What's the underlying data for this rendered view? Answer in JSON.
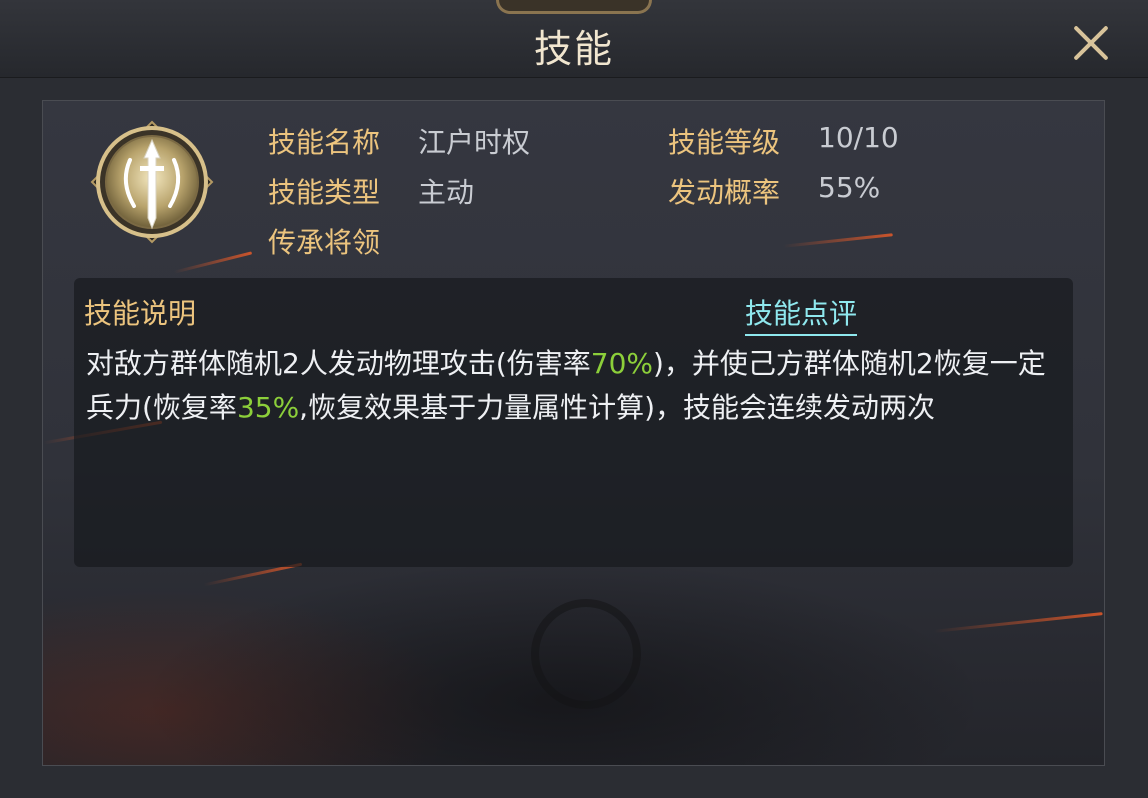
{
  "window": {
    "title": "技能",
    "close_icon": "close-icon"
  },
  "skill": {
    "icon": "sword-emblem-icon",
    "labels": {
      "name": "技能名称",
      "type": "技能类型",
      "inherit": "传承将领",
      "level": "技能等级",
      "rate": "发动概率"
    },
    "values": {
      "name": "江户时权",
      "type": "主动",
      "inherit": "",
      "level": "10/10",
      "rate": "55%"
    }
  },
  "description": {
    "title": "技能说明",
    "review_link": "技能点评",
    "text_parts": [
      "对敌方群体随机2人发动物理攻击(伤害率",
      "70%",
      ")，并使己方群体随机2恢复一定兵力(恢复率",
      "35%",
      ",恢复效果基于力量属性计算)，技能会连续发动两次"
    ],
    "highlight_color": "#8ccf3a"
  },
  "colors": {
    "label": "#ecc47e",
    "value": "#c9ccd2",
    "link": "#8fe8ee",
    "title": "#f1e6cf"
  }
}
